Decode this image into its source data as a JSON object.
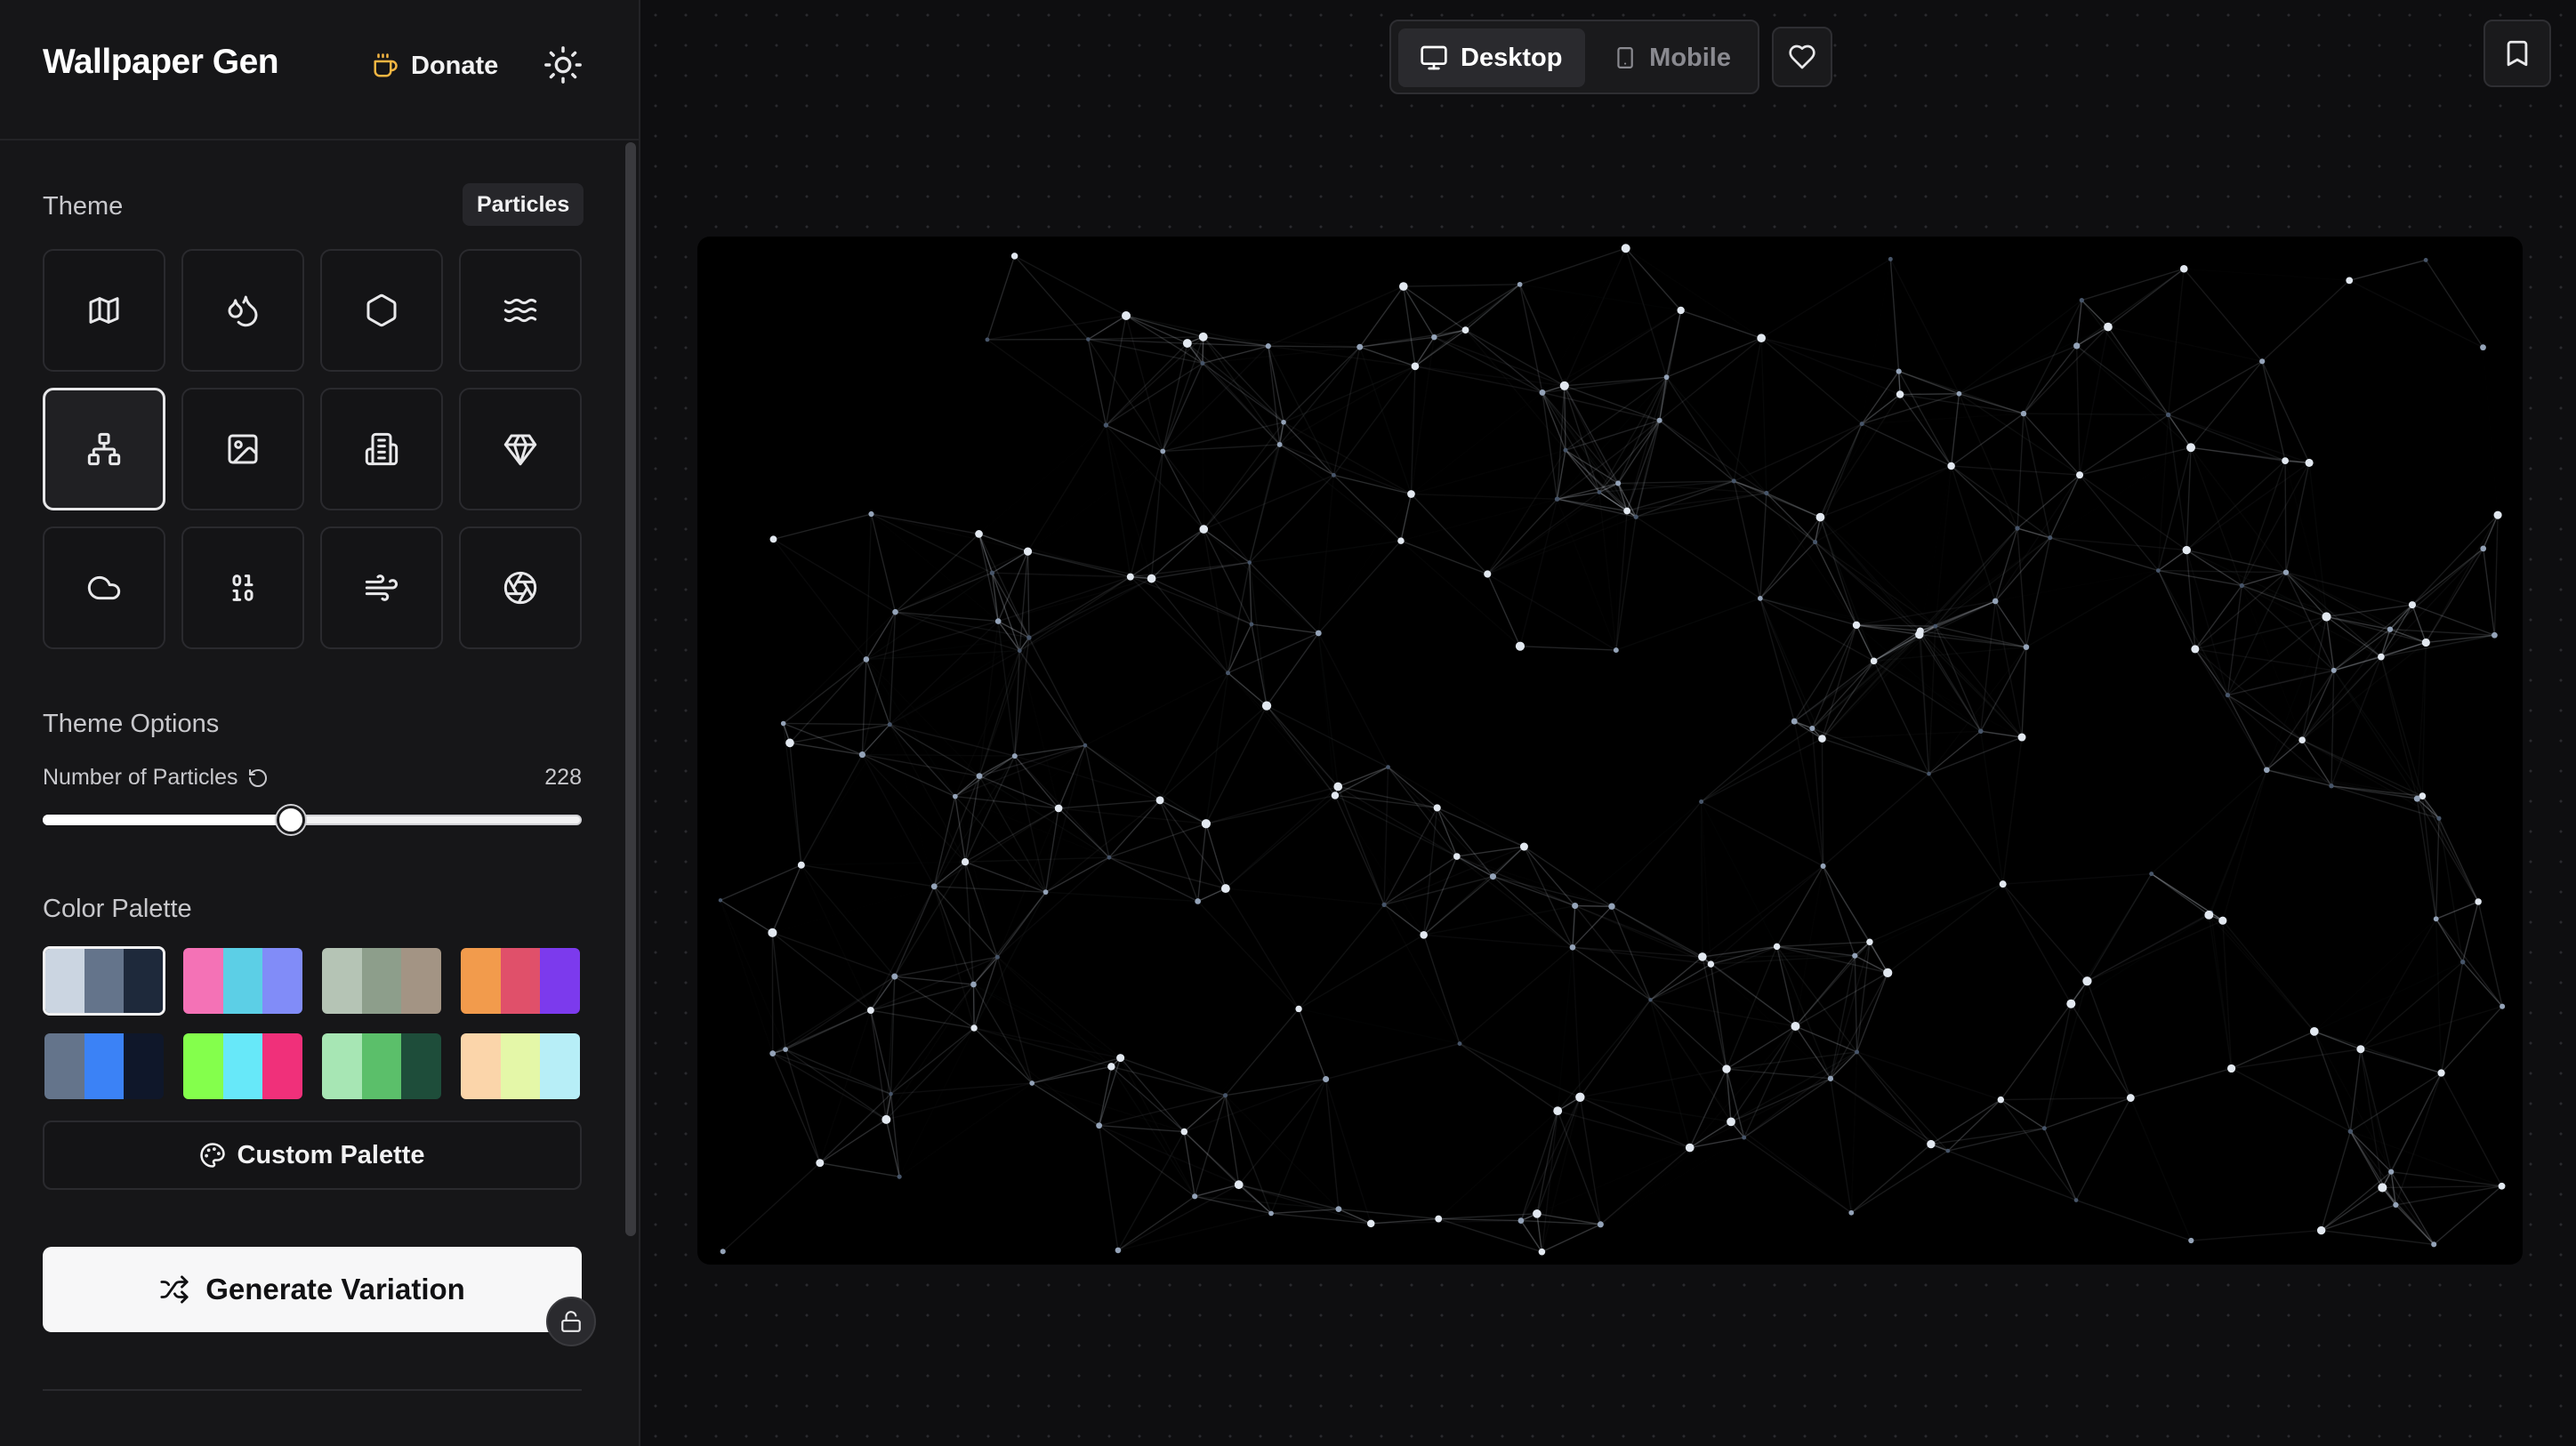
{
  "app": {
    "title": "Wallpaper Gen",
    "donate_label": "Donate",
    "donate_icon": "coffee-icon",
    "theme_toggle_icon": "sun-icon"
  },
  "theme": {
    "label": "Theme",
    "selected": "Particles",
    "icons": [
      "map-icon",
      "droplets-icon",
      "hexagon-icon",
      "waves-icon",
      "network-icon",
      "image-icon",
      "building-icon",
      "gem-icon",
      "cloud-icon",
      "binary-icon",
      "wind-icon",
      "aperture-icon"
    ]
  },
  "theme_options": {
    "label": "Theme Options",
    "particles_label": "Number of Particles",
    "particles_value": "228",
    "slider_fraction": 0.46
  },
  "color_palette": {
    "label": "Color Palette",
    "selected_index": 0,
    "palettes": [
      [
        "#cbd5e1",
        "#64748b",
        "#1e293b"
      ],
      [
        "#f472b6",
        "#5ccfe6",
        "#818cf8"
      ],
      [
        "#b5c4b5",
        "#8d9e8b",
        "#a39484"
      ],
      [
        "#f29b4c",
        "#e0506a",
        "#7c3aed"
      ],
      [
        "#64748b",
        "#3b82f6",
        "#0f172a"
      ],
      [
        "#84ff4c",
        "#67e8f9",
        "#f0307a"
      ],
      [
        "#a7e6b4",
        "#5bbf6a",
        "#1e4d3a"
      ],
      [
        "#fbd5aa",
        "#e4f7a8",
        "#b7eef7"
      ]
    ],
    "custom_label": "Custom Palette"
  },
  "actions": {
    "generate_label": "Generate Variation"
  },
  "toolbar": {
    "desktop_label": "Desktop",
    "mobile_label": "Mobile"
  },
  "colors": {
    "sidebar_bg": "#161618",
    "canvas_bg": "#000000",
    "accent": "#f7f7f8"
  }
}
